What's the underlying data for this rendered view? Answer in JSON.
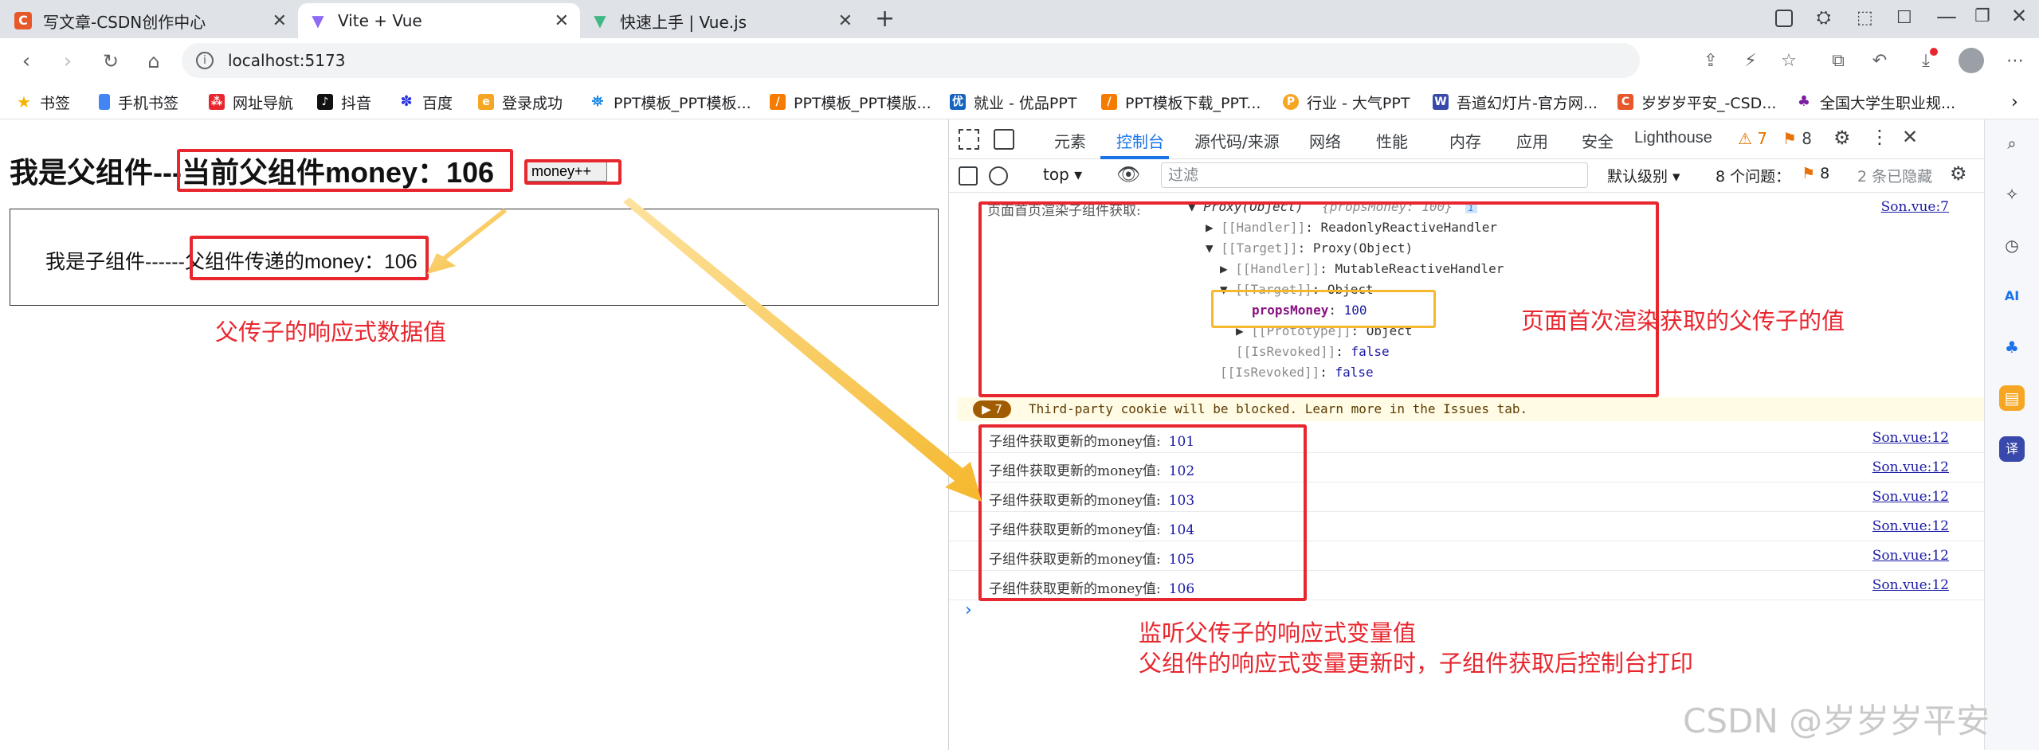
{
  "browser": {
    "tabs": [
      {
        "title": "写文章-CSDN创作中心",
        "icon_color": "#e8572a",
        "icon_letter": "C"
      },
      {
        "title": "Vite + Vue",
        "icon_color": "#8f6bf5",
        "icon_letter": "▼"
      },
      {
        "title": "快速上手 | Vue.js",
        "icon_color": "#41b883",
        "icon_letter": "▼"
      }
    ],
    "new_tab": "+",
    "url": "localhost:5173",
    "bookmarks": [
      {
        "label": "书签",
        "icon": "star-icon",
        "color": "#f5b400"
      },
      {
        "label": "手机书签",
        "icon": "phone-icon",
        "color": "#4285f4"
      },
      {
        "label": "网址导航",
        "icon": "nav-icon",
        "color": "#e8262e"
      },
      {
        "label": "抖音",
        "icon": "douyin-icon",
        "color": "#111111"
      },
      {
        "label": "百度",
        "icon": "baidu-icon",
        "color": "#2932e1"
      },
      {
        "label": "登录成功",
        "icon": "ep-icon",
        "color": "#f5a623"
      },
      {
        "label": "PPT模板_PPT模板...",
        "icon": "ppt-icon",
        "color": "#1e88e5"
      },
      {
        "label": "PPT模板_PPT模版...",
        "icon": "ppt2-icon",
        "color": "#f57c00"
      },
      {
        "label": "就业 - 优品PPT",
        "icon": "youpin-icon",
        "color": "#1565c0"
      },
      {
        "label": "PPT模板下载_PPT...",
        "icon": "ppt3-icon",
        "color": "#f57c00"
      },
      {
        "label": "行业 - 大气PPT",
        "icon": "daqi-icon",
        "color": "#f5a623"
      },
      {
        "label": "吾道幻灯片-官方网...",
        "icon": "wudao-icon",
        "color": "#3949ab"
      },
      {
        "label": "岁岁岁平安_-CSD...",
        "icon": "csdn-icon",
        "color": "#e8572a"
      },
      {
        "label": "全国大学生职业规...",
        "icon": "career-icon",
        "color": "#7b1fa2"
      }
    ]
  },
  "page": {
    "parent_prefix": "我是父组件---",
    "parent_money_text": "当前父组件money：106",
    "button_label": "money++",
    "child_prefix": "我是子组件------",
    "child_money_text": "父组件传递的money：106",
    "annotation_child": "父传子的响应式数据值"
  },
  "devtools": {
    "tabs": [
      "元素",
      "控制台",
      "源代码/来源",
      "网络",
      "性能",
      "内存",
      "应用",
      "安全",
      "Lighthouse"
    ],
    "active_tab": "控制台",
    "warnings_count": "7",
    "errors_count": "8",
    "toolbar": {
      "context": "top",
      "filter_placeholder": "过滤",
      "level": "默认级别",
      "issues_label": "8 个问题：",
      "issues_count": "8",
      "hidden": "2 条已隐藏"
    },
    "first_log": {
      "label": "页面首页渲染子组件获取:",
      "proxy": "Proxy(Object)",
      "preview": "{propsMoney: 100}",
      "source": "Son.vue:7",
      "tree": [
        {
          "indent": 0,
          "arrow": "▶",
          "key": "[[Handler]]",
          "value": "ReadonlyReactiveHandler"
        },
        {
          "indent": 0,
          "arrow": "▼",
          "key": "[[Target]]",
          "value": "Proxy(Object)"
        },
        {
          "indent": 1,
          "arrow": "▶",
          "key": "[[Handler]]",
          "value": "MutableReactiveHandler"
        },
        {
          "indent": 1,
          "arrow": "▼",
          "key": "[[Target]]",
          "value": "Object"
        },
        {
          "indent": 2,
          "arrow": "",
          "key": "propsMoney",
          "value": "100"
        },
        {
          "indent": 2,
          "arrow": "▶",
          "key": "[[Prototype]]",
          "value": "Object"
        },
        {
          "indent": 1,
          "arrow": "",
          "key": "[[IsRevoked]]",
          "value": "false"
        },
        {
          "indent": 0,
          "arrow": "",
          "key": "[[IsRevoked]]",
          "value": "false"
        }
      ]
    },
    "warning": {
      "badge": "7",
      "text": "Third-party cookie will be blocked. Learn more in the Issues tab."
    },
    "logs": [
      {
        "label": "子组件获取更新的money值:",
        "value": "101",
        "source": "Son.vue:12"
      },
      {
        "label": "子组件获取更新的money值:",
        "value": "102",
        "source": "Son.vue:12"
      },
      {
        "label": "子组件获取更新的money值:",
        "value": "103",
        "source": "Son.vue:12"
      },
      {
        "label": "子组件获取更新的money值:",
        "value": "104",
        "source": "Son.vue:12"
      },
      {
        "label": "子组件获取更新的money值:",
        "value": "105",
        "source": "Son.vue:12"
      },
      {
        "label": "子组件获取更新的money值:",
        "value": "106",
        "source": "Son.vue:12"
      }
    ],
    "prompt": "›",
    "annotation_first": "页面首次渲染获取的父传子的值",
    "annotation_watch_1": "监听父传子的响应式变量值",
    "annotation_watch_2": "父组件的响应式变量更新时，子组件获取后控制台打印"
  },
  "watermark": "CSDN @岁岁岁平安"
}
